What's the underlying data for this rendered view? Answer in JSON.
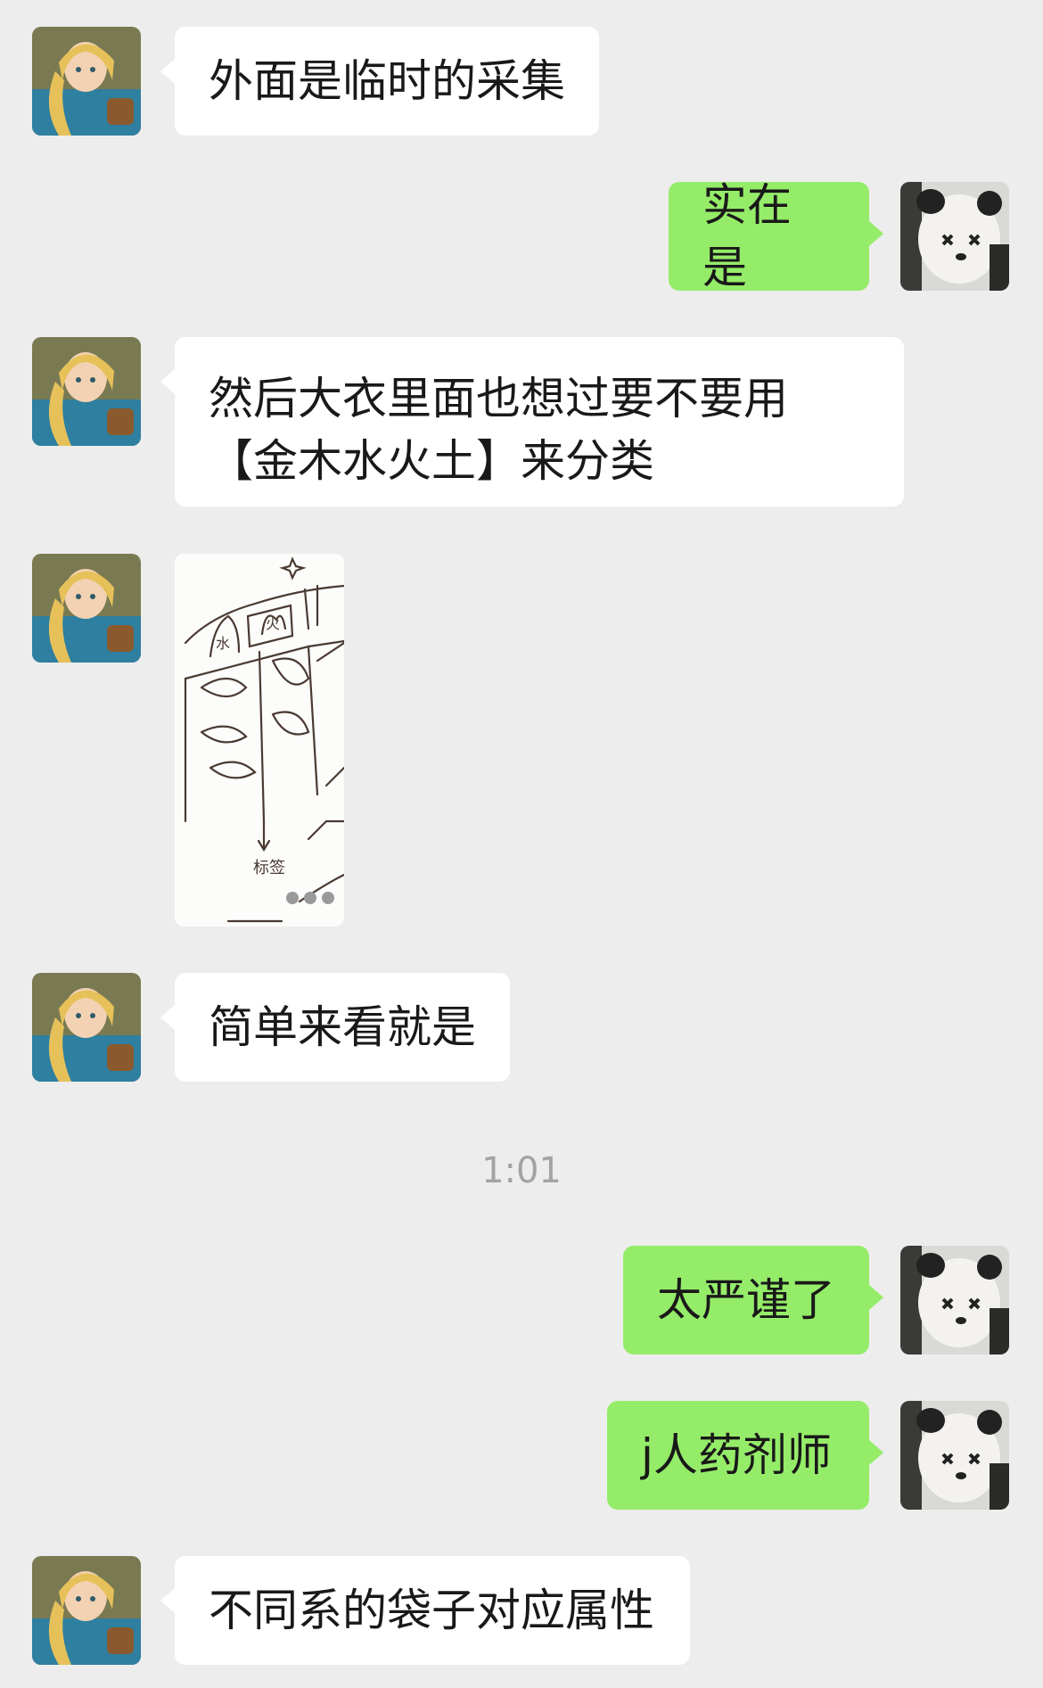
{
  "messages": [
    {
      "side": "in",
      "text": "外面是临时的采集"
    },
    {
      "side": "out",
      "text": "实在是"
    },
    {
      "side": "in",
      "text": "然后大衣里面也想过要不要用【金木水火土】来分类"
    },
    {
      "side": "in",
      "type": "image",
      "image_caption": "hand-drawn sketch of coat compartments",
      "sketch_labels": [
        "水",
        "火",
        "标签"
      ]
    },
    {
      "side": "in",
      "text": "简单来看就是"
    },
    {
      "side": "out",
      "text": "太严谨了"
    },
    {
      "side": "out",
      "text": "j人药剂师"
    },
    {
      "side": "in",
      "text": "不同系的袋子对应属性"
    }
  ],
  "timestamp": "1:01",
  "avatars": {
    "left": "princess-avatar-icon",
    "right": "panda-plush-avatar-icon"
  },
  "colors": {
    "background": "#ededed",
    "incoming_bubble": "#ffffff",
    "outgoing_bubble": "#95ec69",
    "text": "#191919",
    "timestamp": "#a3a3a3"
  }
}
